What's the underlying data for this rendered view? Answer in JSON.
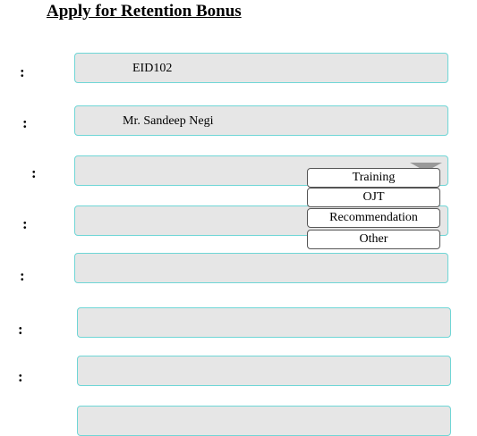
{
  "page_title": "Apply for Retention Bonus",
  "fields": [
    {
      "colon": ":",
      "value": "EID102"
    },
    {
      "colon": ":",
      "value": "Mr. Sandeep Negi"
    },
    {
      "colon": ":",
      "value": ""
    },
    {
      "colon": ":",
      "value": ""
    },
    {
      "colon": ":",
      "value": ""
    },
    {
      "colon": ":",
      "value": ""
    },
    {
      "colon": ":",
      "value": ""
    }
  ],
  "dropdown": {
    "options": [
      "Training",
      "OJT",
      "Recommendation",
      "Other"
    ]
  },
  "colors": {
    "field_background": "#e6e6e6",
    "field_border": "#6fd6d6"
  }
}
